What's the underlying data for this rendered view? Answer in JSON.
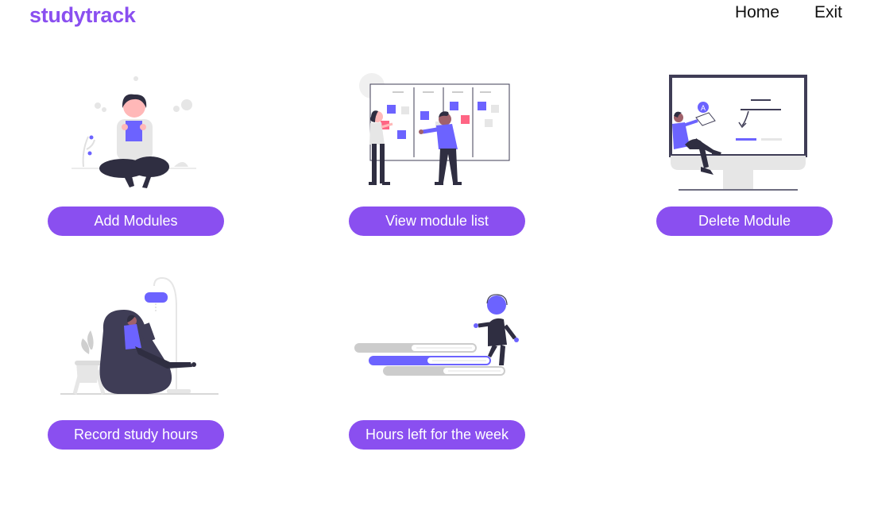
{
  "header": {
    "logo": "studytrack",
    "nav": {
      "home": "Home",
      "exit": "Exit"
    }
  },
  "cards": {
    "add_modules": {
      "label": "Add Modules",
      "illustration": "woman-reading-cross-legged"
    },
    "view_module_list": {
      "label": "View module list",
      "illustration": "people-at-kanban-board"
    },
    "delete_module": {
      "label": "Delete Module",
      "illustration": "person-on-monitor"
    },
    "record_study_hours": {
      "label": "Record study hours",
      "illustration": "woman-in-beanbag-reading"
    },
    "hours_left": {
      "label": "Hours left for the week",
      "illustration": "person-on-books-stairs"
    }
  },
  "colors": {
    "brand": "#8a4ff0",
    "accent": "#6c63ff",
    "pink": "#ff6584",
    "dark": "#2f2e41"
  }
}
